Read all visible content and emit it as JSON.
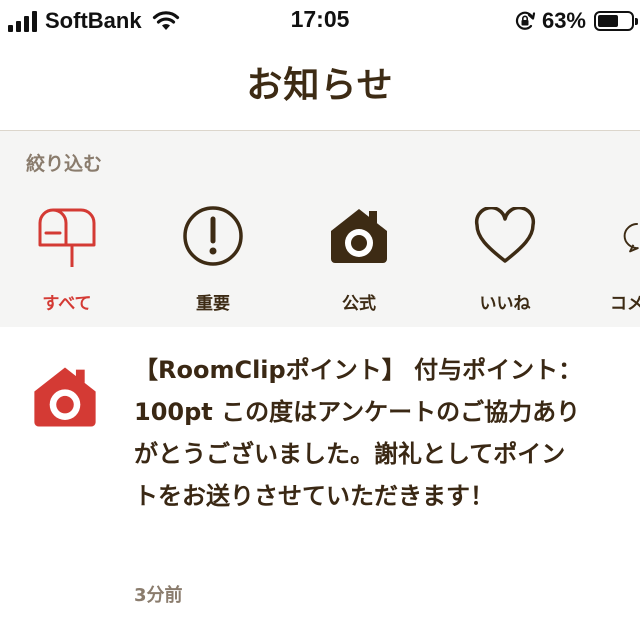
{
  "status_bar": {
    "carrier": "SoftBank",
    "time": "17:05",
    "battery_percent": "63%",
    "battery_level": 0.63
  },
  "header": {
    "title": "お知らせ"
  },
  "filter": {
    "label": "絞り込む",
    "items": [
      {
        "label": "すべて",
        "icon": "mailbox-icon",
        "active": true
      },
      {
        "label": "重要",
        "icon": "exclamation-circle-icon",
        "active": false
      },
      {
        "label": "公式",
        "icon": "roomclip-house-camera-icon",
        "active": false
      },
      {
        "label": "いいね",
        "icon": "heart-icon",
        "active": false
      },
      {
        "label": "コメ",
        "icon": "speech-bubble-icon",
        "active": false
      }
    ]
  },
  "notices": [
    {
      "text": "【RoomClipポイント】 付与ポイント：100pt この度はアンケートのご協力ありがとうございました。謝礼としてポイントをお送りさせていただきます！",
      "time": "3分前",
      "icon": "roomclip-house-camera-icon"
    }
  ],
  "colors": {
    "accent_red": "#d43a34",
    "brown_text": "#3d2b14",
    "muted_text": "#8a7c6d",
    "filter_bg": "#f5f5f4"
  }
}
